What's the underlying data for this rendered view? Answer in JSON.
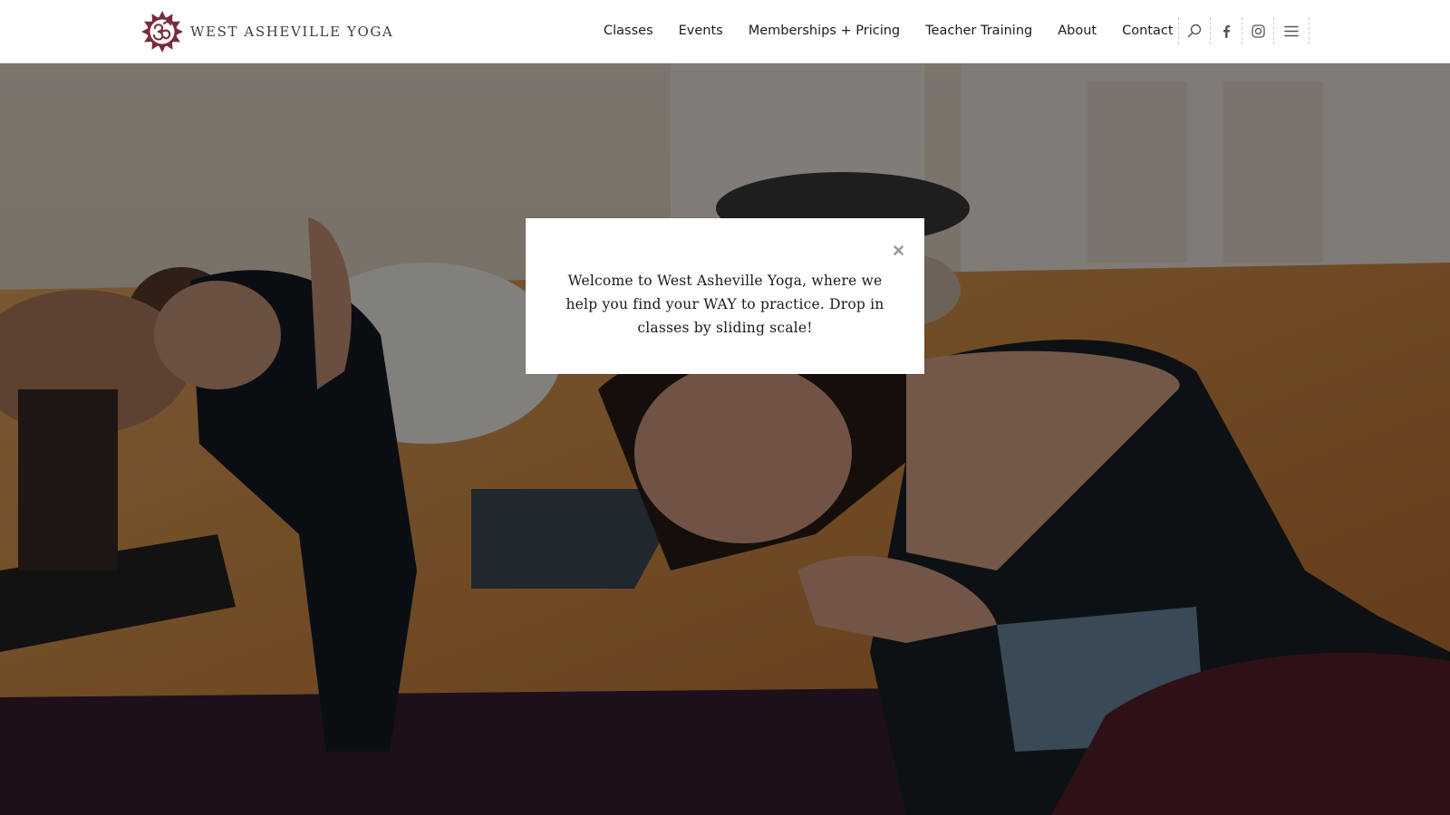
{
  "brand": {
    "name": "WEST ASHEVILLE YOGA",
    "logo_icon": "om-mandala-logo",
    "color": "#7a2b3c"
  },
  "nav": {
    "items": [
      {
        "label": "Classes"
      },
      {
        "label": "Events"
      },
      {
        "label": "Memberships + Pricing"
      },
      {
        "label": "Teacher Training"
      },
      {
        "label": "About"
      },
      {
        "label": "Contact"
      }
    ],
    "icons": [
      "search-icon",
      "facebook-icon",
      "instagram-icon",
      "hamburger-menu-icon"
    ]
  },
  "hero": {
    "image": "yoga-class-photo"
  },
  "modal": {
    "close_icon": "close-icon",
    "message": "Welcome to West Asheville Yoga, where we help you find your WAY to practice. Drop in classes by sliding scale!"
  },
  "colors": {
    "header_bg": "#ffffff",
    "nav_text": "#1c1c1c",
    "overlay": "rgba(0,0,0,0.47)"
  }
}
